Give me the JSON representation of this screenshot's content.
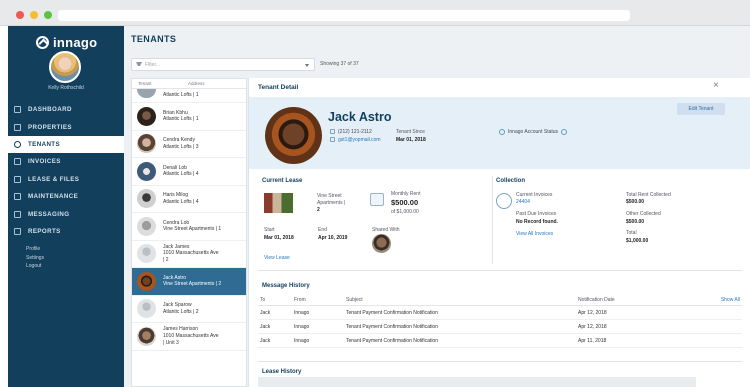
{
  "brand": {
    "name": "innago"
  },
  "user": {
    "name": "Kelly Rothschild"
  },
  "nav": {
    "items": [
      {
        "label": "DASHBOARD",
        "icon": "dashboard-icon",
        "active": false
      },
      {
        "label": "PROPERTIES",
        "icon": "building-icon",
        "active": false
      },
      {
        "label": "TENANTS",
        "icon": "users-icon",
        "active": true
      },
      {
        "label": "INVOICES",
        "icon": "invoice-icon",
        "active": false
      },
      {
        "label": "LEASE & FILES",
        "icon": "file-icon",
        "active": false
      },
      {
        "label": "MAINTENANCE",
        "icon": "wrench-icon",
        "active": false
      },
      {
        "label": "MESSAGING",
        "icon": "envelope-icon",
        "active": false
      },
      {
        "label": "REPORTS",
        "icon": "chart-icon",
        "active": false
      }
    ],
    "links": [
      "Profile",
      "Settings",
      "Logout"
    ]
  },
  "page": {
    "title": "TENANTS"
  },
  "filter": {
    "placeholder": "Filter...",
    "showing": "Showing 37 of 37"
  },
  "list": {
    "col_tenant": "Tenant",
    "col_address": "Address",
    "rows": [
      {
        "name": "",
        "address": "Atlantic Lofts | 1",
        "active": false
      },
      {
        "name": "Brian Kbhu",
        "address": "Atlantic Lofts | 1",
        "active": false
      },
      {
        "name": "Cendra Kendy",
        "address": "Atlantic Lofts | 3",
        "active": false
      },
      {
        "name": "Denali Lob",
        "address": "Atlantic Lofts | 4",
        "active": false
      },
      {
        "name": "Haris Milog",
        "address": "Atlantic Lofts | 4",
        "active": false
      },
      {
        "name": "Cendra Lob",
        "address": "Vine Street Apartments | 1",
        "active": false
      },
      {
        "name": "Jack James",
        "address": "1010 Massachusetts Ave",
        "address2": "| 2",
        "active": false
      },
      {
        "name": "Jack Astro",
        "address": "Vine Street Apartments | 2",
        "active": true
      },
      {
        "name": "Jack Sparow",
        "address": "Atlantic Lofts | 2",
        "active": false
      },
      {
        "name": "James Harrison",
        "address": "1010 Massachusetts Ave",
        "address2": "| Unit 3",
        "active": false
      }
    ]
  },
  "detail": {
    "title": "Tenant Detail",
    "name": "Jack Astro",
    "phone": "(212) 121-2112",
    "email": "gst1@yopmail.com",
    "tenant_since_label": "Tenant Since",
    "tenant_since": "Mar 01, 2018",
    "account_status": "Innago Account Status",
    "edit_label": "Edit Tenant",
    "lease": {
      "title": "Current Lease",
      "property_line1": "Vine Street",
      "property_line2": "Apartments |",
      "property_line3": "2",
      "rent_label": "Monthly Rent",
      "rent": "$500.00",
      "rent_of": "of $1,000.00",
      "start_label": "Start",
      "start": "Mar 01, 2018",
      "end_label": "End",
      "end": "Apr 10, 2019",
      "shared_label": "Shared With",
      "view_lease": "View Lease"
    },
    "collection": {
      "title": "Collection",
      "current_label": "Current Invoices",
      "current": "24404",
      "past_label": "Past Due Invoices",
      "past": "No Record found.",
      "view_all": "View All Invoices",
      "total_rent_label": "Total Rent Collected",
      "total_rent": "$500.00",
      "other_label": "Other Collected",
      "other": "$500.00",
      "total_label": "Total",
      "total": "$1,000.00"
    },
    "messages": {
      "title": "Message History",
      "headers": {
        "to": "To",
        "from": "From",
        "subject": "Subject",
        "date": "Notification Date",
        "show_all": "Show All"
      },
      "rows": [
        {
          "to": "Jack",
          "from": "Innago",
          "subject": "Tenant Payment Confirmation Notification",
          "date": "Apr 12, 2018"
        },
        {
          "to": "Jack",
          "from": "Innago",
          "subject": "Tenant Payment Confirmation Notification",
          "date": "Apr 12, 2018"
        },
        {
          "to": "Jack",
          "from": "Innago",
          "subject": "Tenant Payment Confirmation Notification",
          "date": "Apr 11, 2018"
        }
      ]
    },
    "lease_history_title": "Lease History"
  }
}
